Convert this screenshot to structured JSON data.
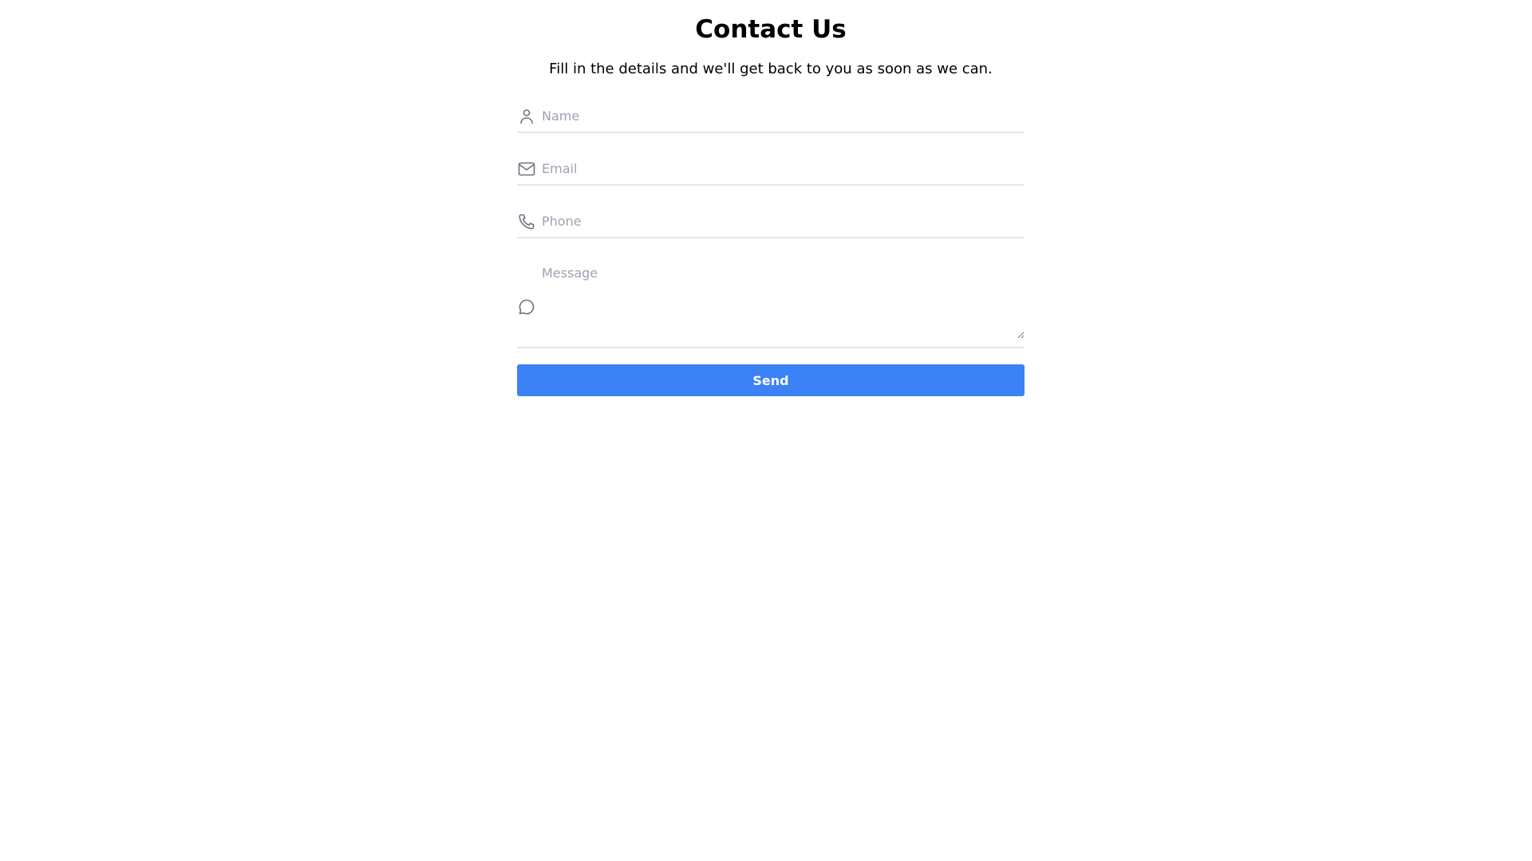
{
  "header": {
    "title": "Contact Us",
    "subtitle": "Fill in the details and we'll get back to you as soon as we can."
  },
  "form": {
    "name": {
      "placeholder": "Name",
      "value": "",
      "icon": "user-icon"
    },
    "email": {
      "placeholder": "Email",
      "value": "",
      "icon": "mail-icon"
    },
    "phone": {
      "placeholder": "Phone",
      "value": "",
      "icon": "phone-icon"
    },
    "message": {
      "placeholder": "Message",
      "value": "",
      "icon": "chat-bubble-icon"
    },
    "submit_label": "Send"
  },
  "colors": {
    "accent": "#3b82f6",
    "icon": "#6b7280",
    "placeholder": "#9ca3af",
    "divider": "#e5e7eb"
  }
}
